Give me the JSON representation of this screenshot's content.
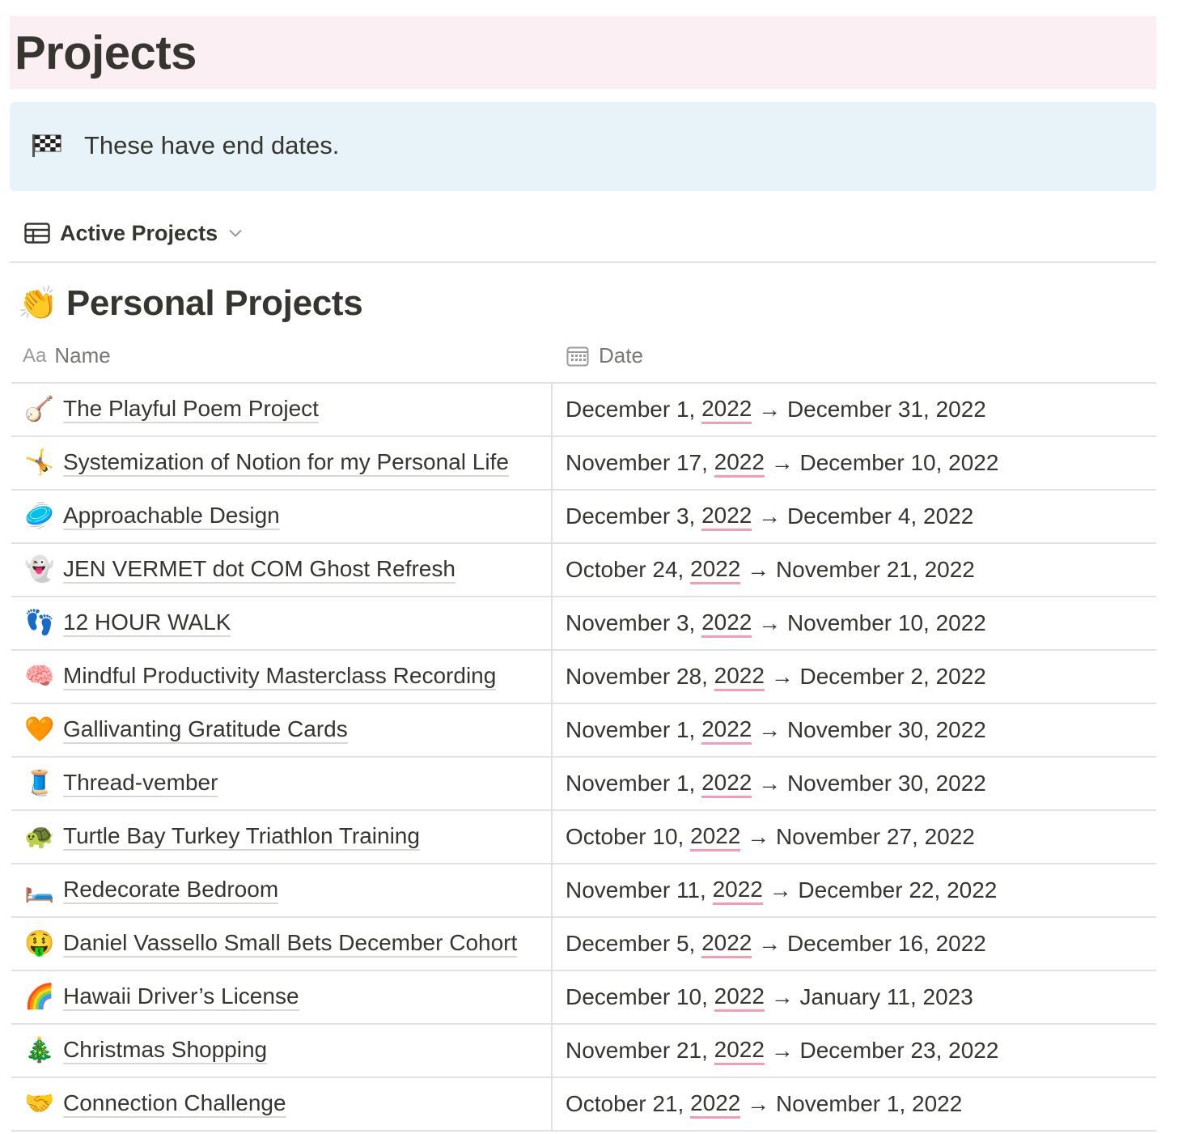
{
  "page": {
    "title": "Projects"
  },
  "callout": {
    "icon": "checkered-flag-icon",
    "text": "These have end dates."
  },
  "view": {
    "label": "Active Projects",
    "icon": "table-icon"
  },
  "group": {
    "emoji": "👏",
    "title": "Personal Projects"
  },
  "columns": {
    "name_prefix": "Aa",
    "name": "Name",
    "date": "Date"
  },
  "rows": [
    {
      "emoji": "🪕",
      "name": "The Playful Poem Project",
      "start": "December 1, 2022",
      "end": "December 31, 2022"
    },
    {
      "emoji": "🤸",
      "name": "Systemization of Notion for my Personal Life",
      "start": "November 17, 2022",
      "end": "December 10, 2022"
    },
    {
      "emoji": "🥏",
      "name": "Approachable Design",
      "start": "December 3, 2022",
      "end": "December 4, 2022"
    },
    {
      "emoji": "👻",
      "name": "JEN VERMET dot COM Ghost Refresh",
      "start": "October 24, 2022",
      "end": "November 21, 2022"
    },
    {
      "emoji": "👣",
      "name": "12 HOUR WALK",
      "start": "November 3, 2022",
      "end": "November 10, 2022"
    },
    {
      "emoji": "🧠",
      "name": "Mindful Productivity Masterclass Recording",
      "start": "November 28, 2022",
      "end": "December 2, 2022"
    },
    {
      "emoji": "🧡",
      "name": "Gallivanting Gratitude Cards",
      "start": "November 1, 2022",
      "end": "November 30, 2022"
    },
    {
      "emoji": "🧵",
      "name": "Thread-vember",
      "start": "November 1, 2022",
      "end": "November 30, 2022"
    },
    {
      "emoji": "🐢",
      "name": "Turtle Bay Turkey Triathlon Training",
      "start": "October 10, 2022",
      "end": "November 27, 2022"
    },
    {
      "emoji": "🛏️",
      "name": "Redecorate Bedroom",
      "start": "November 11, 2022",
      "end": "December 22, 2022"
    },
    {
      "emoji": "🤑",
      "name": "Daniel Vassello Small Bets December Cohort",
      "start": "December 5, 2022",
      "end": "December 16, 2022"
    },
    {
      "emoji": "🌈",
      "name": "Hawaii Driver’s License",
      "start": "December 10, 2022",
      "end": "January 11, 2023"
    },
    {
      "emoji": "🎄",
      "name": "Christmas Shopping",
      "start": "November 21, 2022",
      "end": "December 23, 2022"
    },
    {
      "emoji": "🤝",
      "name": "Connection Challenge",
      "start": "October 21, 2022",
      "end": "November 1, 2022"
    }
  ],
  "arrow": "→",
  "colors": {
    "banner": "#fbeff3",
    "callout": "#e7f3f8",
    "spellcheck": "#f29cb5",
    "divider": "#e3e2e0"
  }
}
